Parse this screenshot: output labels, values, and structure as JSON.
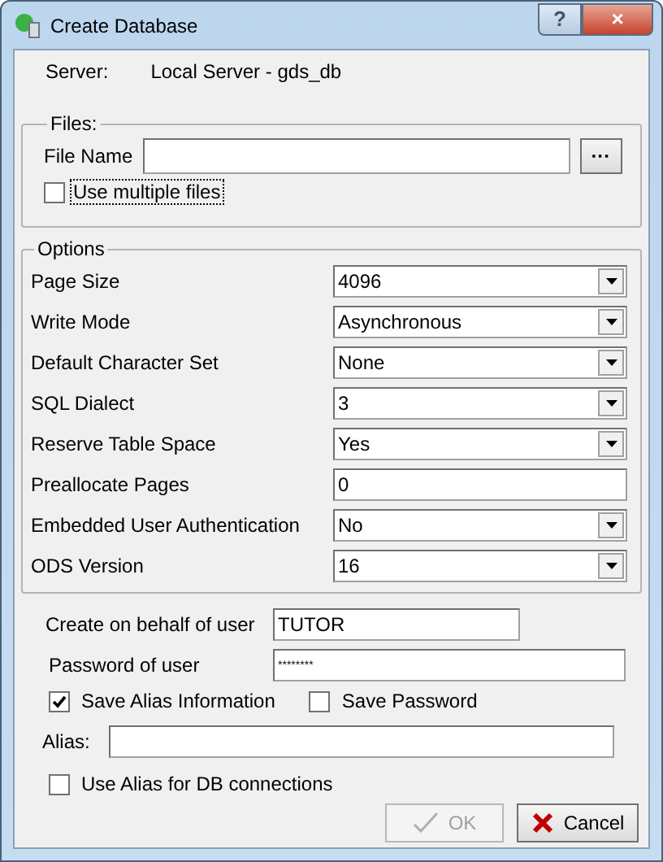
{
  "window": {
    "title": "Create Database",
    "help_button": "?",
    "close_button": "×"
  },
  "server": {
    "label": "Server:",
    "value": "Local Server - gds_db"
  },
  "files": {
    "legend": "Files:",
    "file_name": {
      "label": "File Name"
    },
    "browse_button": "···",
    "multiple_files": {
      "label": "Use multiple files",
      "checked": false,
      "focused": true
    }
  },
  "options": {
    "legend": "Options",
    "rows": [
      {
        "label": "Page Size",
        "kind": "select",
        "value": "4096"
      },
      {
        "label": "Write Mode",
        "kind": "select",
        "value": "Asynchronous"
      },
      {
        "label": "Default Character Set",
        "kind": "select",
        "value": "None"
      },
      {
        "label": "SQL Dialect",
        "kind": "select",
        "value": "3"
      },
      {
        "label": "Reserve Table Space",
        "kind": "select",
        "value": "Yes"
      },
      {
        "label": "Preallocate Pages",
        "kind": "input",
        "value": "0"
      },
      {
        "label": "Embedded User Authentication",
        "kind": "select",
        "value": "No"
      },
      {
        "label": "ODS Version",
        "kind": "select",
        "value": "16"
      }
    ]
  },
  "user": {
    "label": "Create on behalf of user",
    "value": "TUTOR"
  },
  "password": {
    "label": "Password of user",
    "value": "********"
  },
  "save_alias": {
    "label": "Save Alias Information",
    "checked": true
  },
  "save_password": {
    "label": "Save Password",
    "checked": false
  },
  "alias": {
    "label": "Alias:"
  },
  "use_alias": {
    "label": "Use Alias for DB connections",
    "checked": false
  },
  "buttons": [
    {
      "label": "OK",
      "kind": "ok",
      "disabled": true
    },
    {
      "label": "Cancel",
      "kind": "cancel",
      "disabled": false
    }
  ]
}
